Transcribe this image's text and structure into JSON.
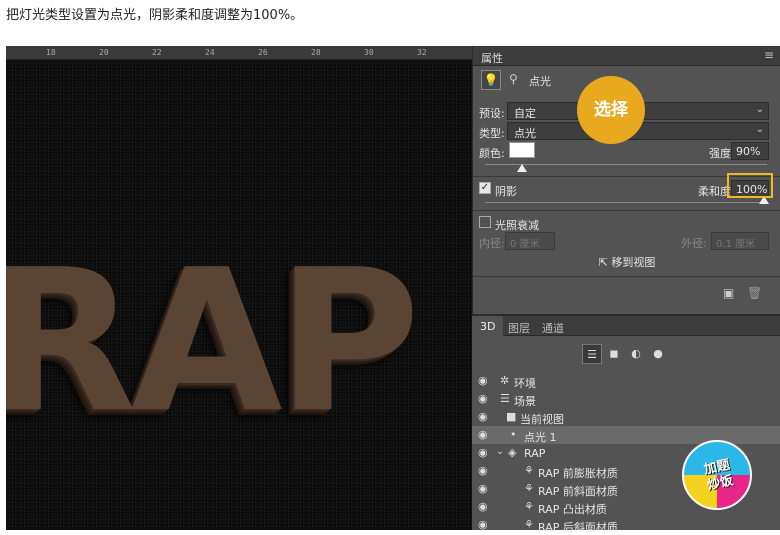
{
  "caption": "把灯光类型设置为点光，阴影柔和度调整为100%。",
  "canvas": {
    "ruler_ticks": [
      "18",
      "20",
      "22",
      "24",
      "26",
      "28",
      "30",
      "32"
    ],
    "text": "RAP"
  },
  "properties_panel": {
    "title": "属性",
    "light_type": "点光",
    "preset_label": "预设:",
    "preset_value": "自定",
    "type_label": "类型:",
    "type_value": "点光",
    "color_label": "颜色:",
    "color_value": "#ffffff",
    "intensity_label": "强度:",
    "intensity_value": "90%",
    "intensity_fraction": 0.9,
    "shadow_label": "阴影",
    "softness_label": "柔和度:",
    "softness_value": "100%",
    "softness_fraction": 1.0,
    "falloff_label": "光照衰减",
    "inner_label": "内径:",
    "inner_value": "0 厘米",
    "outer_label": "外径:",
    "outer_value": "0.1 厘米",
    "move_to_view": "移到视图"
  },
  "callout": "选择",
  "layers_panel": {
    "tabs": [
      "3D",
      "图层",
      "通道"
    ],
    "items": [
      {
        "name": "环境",
        "icon": "env"
      },
      {
        "name": "场景",
        "icon": "scene"
      },
      {
        "name": "当前视图",
        "icon": "camera"
      },
      {
        "name": "点光 1",
        "icon": "light"
      },
      {
        "name": "RAP",
        "icon": "mesh"
      },
      {
        "name": "RAP 前膨胀材质",
        "icon": "mat"
      },
      {
        "name": "RAP 前斜面材质",
        "icon": "mat"
      },
      {
        "name": "RAP 凸出材质",
        "icon": "mat"
      },
      {
        "name": "RAP 后斜面材质",
        "icon": "mat"
      }
    ]
  },
  "logo_text": "加题 炒饭"
}
